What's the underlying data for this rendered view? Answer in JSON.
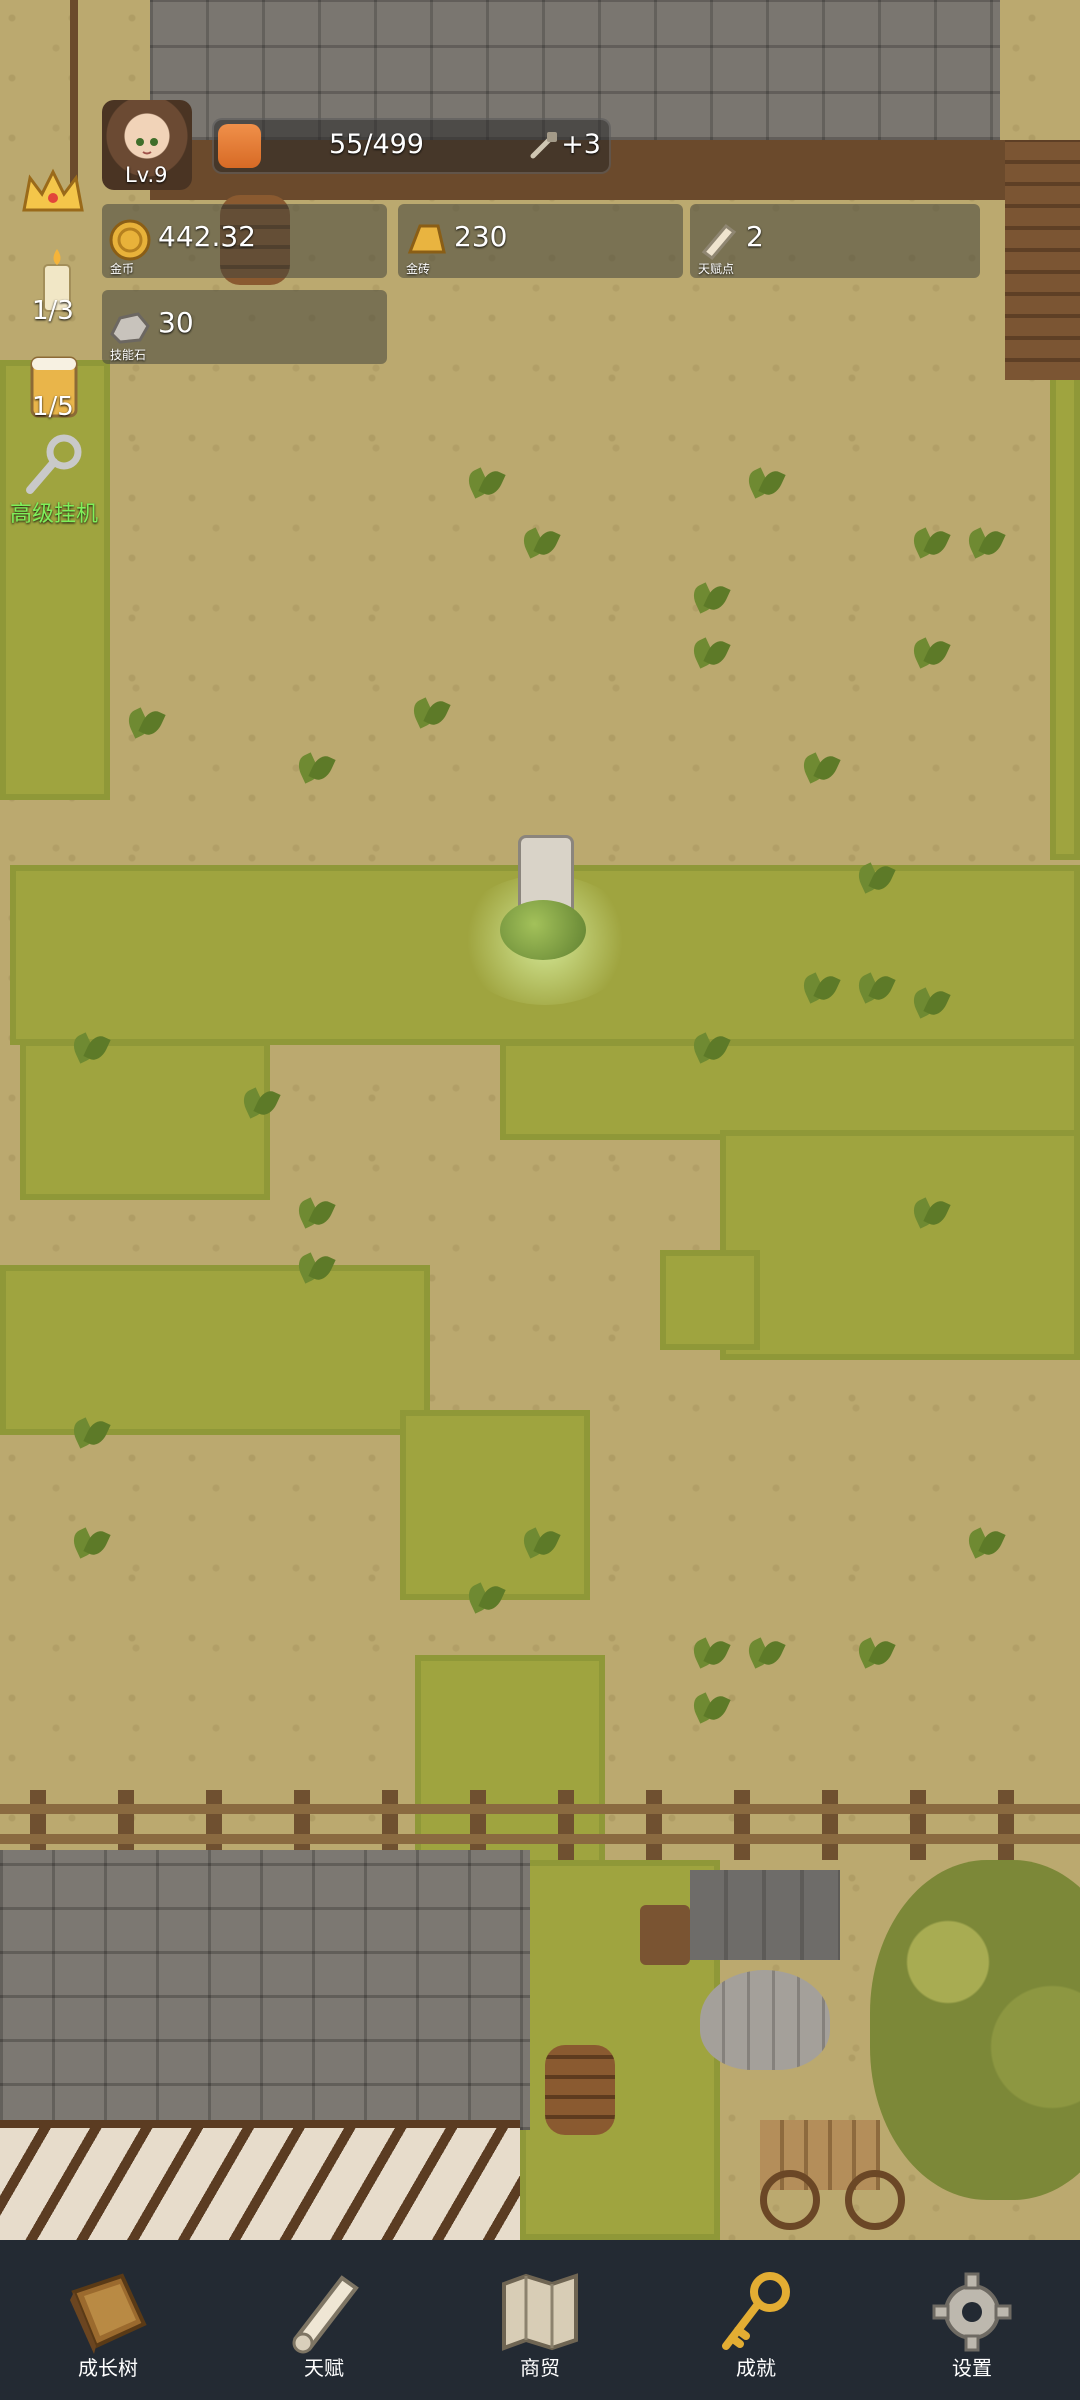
{
  "player": {
    "level": "Lv.9",
    "xp_text": "55/499",
    "xp_progress": 0.11,
    "xp_bonus": "+3"
  },
  "resources": [
    {
      "name": "gold-coin",
      "value": "442.32",
      "label": "金币",
      "icon": "coin-icon"
    },
    {
      "name": "gold-bar",
      "value": "230",
      "label": "金砖",
      "icon": "gold-bar-icon"
    },
    {
      "name": "talent-point",
      "value": "2",
      "label": "天赋点",
      "icon": "scroll-icon"
    },
    {
      "name": "skill-stone",
      "value": "30",
      "label": "技能石",
      "icon": "stone-icon"
    }
  ],
  "side": {
    "candle_count": "1/3",
    "beer_count": "1/5",
    "afk_label": "高级挂机"
  },
  "nav": [
    {
      "label": "成长树",
      "icon": "book-icon"
    },
    {
      "label": "天赋",
      "icon": "scroll-icon"
    },
    {
      "label": "商贸",
      "icon": "map-icon"
    },
    {
      "label": "成就",
      "icon": "key-icon"
    },
    {
      "label": "设置",
      "icon": "gear-icon"
    }
  ],
  "colors": {
    "nav_bg": "#232a33",
    "xp_fill": "#e07a35",
    "afk_text": "#7ff05a"
  }
}
